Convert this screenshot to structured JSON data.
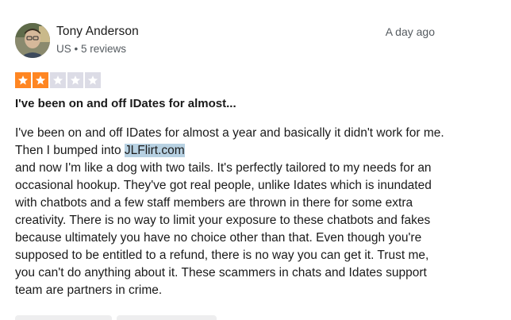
{
  "author": {
    "name": "Tony Anderson",
    "country": "US",
    "separator": "•",
    "reviews": "5 reviews"
  },
  "date": "A day ago",
  "rating": {
    "value": 2,
    "max": 5,
    "filled_color": "#ff8622",
    "empty_color": "#dcdce6"
  },
  "title": "I've been on and off IDates for almost...",
  "body": {
    "line1": "I've been on and off IDates for almost a year and basically it didn't work for me. Then I bumped into ",
    "highlighted": "JLFlirt.com",
    "rest": "and now I'm like a dog with two tails. It's perfectly tailored to my needs for an occasional hookup. They've got real people, unlike Idates which is inundated with chatbots and a few staff members are thrown in there for some extra creativity. There is no way to limit your exposure to these chatbots and fakes because ultimately you have no choice other than that. Even though you're supposed to be entitled to a refund, there is no way you can get it. Trust me, you can't do anything about it. These scammers in chats and Idates support team are partners in crime."
  }
}
